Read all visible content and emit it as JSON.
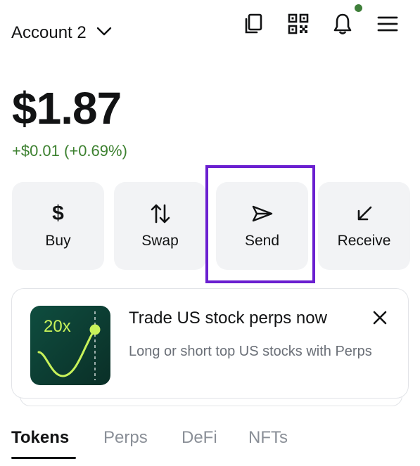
{
  "header": {
    "account_name": "Account 2"
  },
  "balance": {
    "amount": "$1.87",
    "change": "+$0.01 (+0.69%)"
  },
  "actions": [
    {
      "label": "Buy",
      "icon": "dollar-icon"
    },
    {
      "label": "Swap",
      "icon": "swap-arrows-icon"
    },
    {
      "label": "Send",
      "icon": "send-icon"
    },
    {
      "label": "Receive",
      "icon": "receive-arrow-icon"
    }
  ],
  "promo": {
    "badge": "20x",
    "title": "Trade US stock perps now",
    "description": "Long or short top US stocks with Perps"
  },
  "tabs": [
    {
      "label": "Tokens",
      "active": true
    },
    {
      "label": "Perps",
      "active": false
    },
    {
      "label": "DeFi",
      "active": false
    },
    {
      "label": "NFTs",
      "active": false
    }
  ],
  "colors": {
    "positive": "#3d8130",
    "highlight": "#6a1fd0",
    "notification_dot": "#3f7f3a",
    "promo_accent": "#c8f25a"
  }
}
